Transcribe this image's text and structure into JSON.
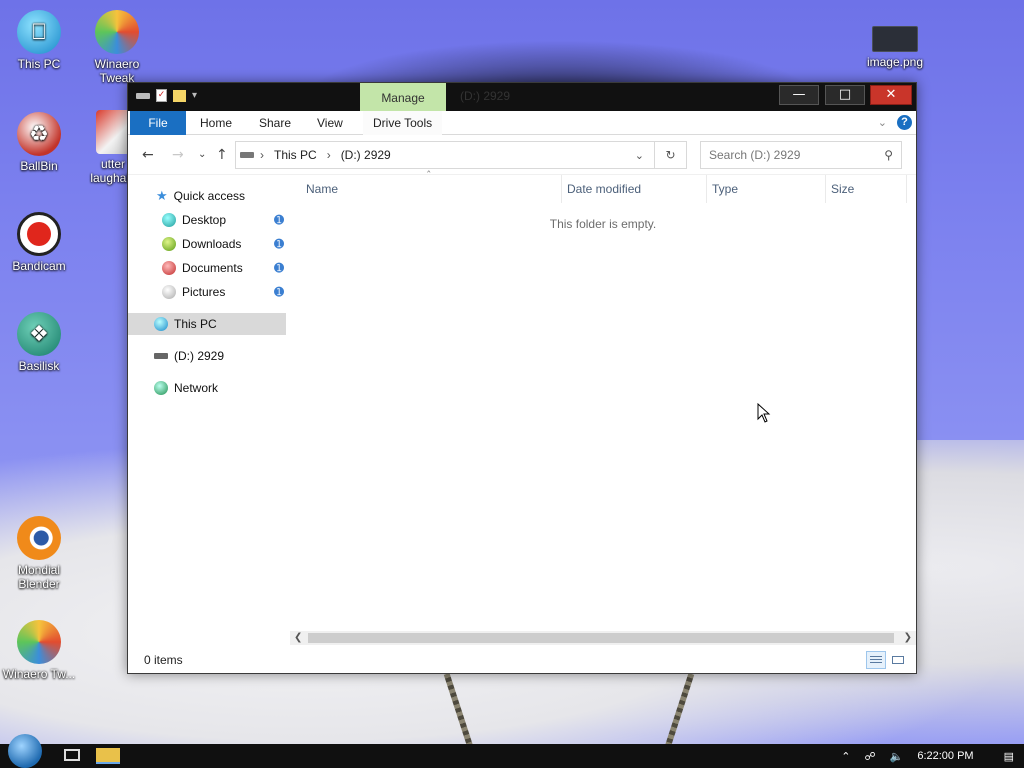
{
  "desktop": {
    "icons": [
      {
        "label": "This PC",
        "icon": "this-pc-icon"
      },
      {
        "label": "Winaero Tweak",
        "icon": "winaero-tweaker-icon"
      },
      {
        "label": "BallBin",
        "icon": "recycle-bin-icon"
      },
      {
        "label": "utter laughabl",
        "icon": "app-box-icon"
      },
      {
        "label": "Bandicam",
        "icon": "bandicam-icon"
      },
      {
        "label": "Basilisk",
        "icon": "basilisk-browser-icon"
      },
      {
        "label": "Mondial Blender",
        "icon": "blender-icon"
      },
      {
        "label": "Winaero Tw...",
        "icon": "winaero-tweaker-icon"
      },
      {
        "label": "image.png",
        "icon": "image-file-icon"
      }
    ]
  },
  "window": {
    "title": "(D:) 2929",
    "manage_tab": "Manage",
    "ribbon_tabs": [
      "File",
      "Home",
      "Share",
      "View",
      "Drive Tools"
    ],
    "address": {
      "segments": [
        "This PC",
        "(D:) 2929"
      ]
    },
    "search": {
      "placeholder": "Search (D:) 2929"
    },
    "nav_pane": {
      "quick_access": "Quick access",
      "pinned": [
        "Desktop",
        "Downloads",
        "Documents",
        "Pictures"
      ],
      "this_pc": "This PC",
      "drive": "(D:) 2929",
      "network": "Network"
    },
    "columns": [
      "Name",
      "Date modified",
      "Type",
      "Size"
    ],
    "empty_message": "This folder is empty.",
    "status": {
      "items": "0 items"
    }
  },
  "taskbar": {
    "clock": "6:22:00 PM"
  },
  "colors": {
    "file_tab": "#1a6fc2",
    "manage_tab": "#c3e5a9",
    "close_button": "#c9352a"
  }
}
